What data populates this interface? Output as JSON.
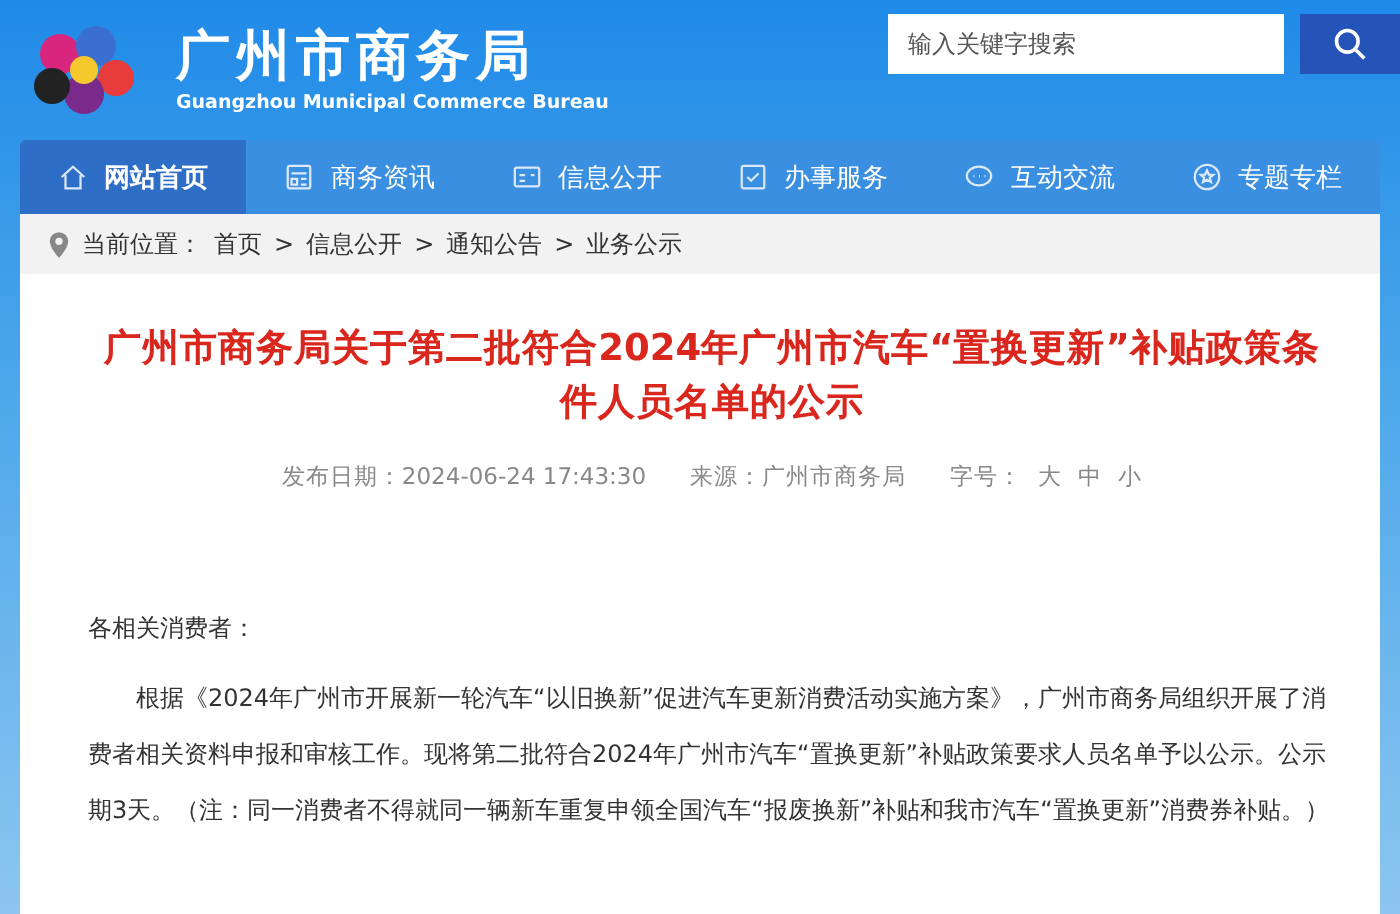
{
  "header": {
    "title": "广州市商务局",
    "subtitle": "Guangzhou Municipal Commerce Bureau",
    "search": {
      "placeholder": "输入关键字搜索"
    }
  },
  "nav": [
    {
      "label": "网站首页",
      "kind": "home",
      "selected": true
    },
    {
      "label": "商务资讯",
      "kind": "news",
      "selected": false
    },
    {
      "label": "信息公开",
      "kind": "card",
      "selected": false
    },
    {
      "label": "办事服务",
      "kind": "check",
      "selected": false
    },
    {
      "label": "互动交流",
      "kind": "chat",
      "selected": false
    },
    {
      "label": "专题专栏",
      "kind": "star",
      "selected": false
    }
  ],
  "breadcrumb": {
    "label": "当前位置：",
    "items": [
      "首页",
      "信息公开",
      "通知公告",
      "业务公示"
    ],
    "separator": ">"
  },
  "article": {
    "title": "广州市商务局关于第二批符合2024年广州市汽车“置换更新”补贴政策条件人员名单的公示",
    "meta": {
      "date_label": "发布日期：",
      "date": "2024-06-24 17:43:30",
      "source_label": "来源：",
      "source": "广州市商务局",
      "size_label": "字号：",
      "sizes": [
        "大",
        "中",
        "小"
      ]
    },
    "greeting": "各相关消费者：",
    "paragraphs": [
      "根据《2024年广州市开展新一轮汽车“以旧换新”促进汽车更新消费活动实施方案》，广州市商务局组织开展了消费者相关资料申报和审核工作。现将第二批符合2024年广州市汽车“置换更新”补贴政策要求人员名单予以公示。公示期3天。（注：同一消费者不得就同一辆新车重复申领全国汽车“报废换新”补贴和我市汽车“置换更新”消费券补贴。）"
    ]
  }
}
